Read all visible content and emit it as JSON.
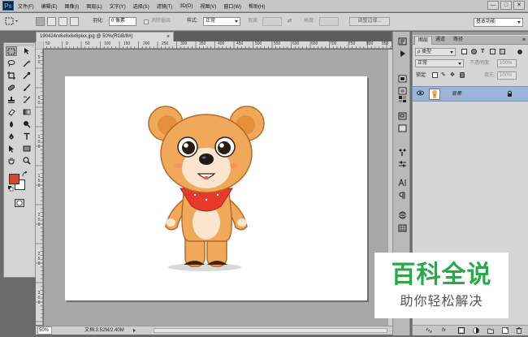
{
  "app": {
    "logo": "Ps"
  },
  "menu": [
    "文件(F)",
    "编辑(E)",
    "图像(I)",
    "图层(L)",
    "文字(Y)",
    "选择(S)",
    "滤镜(T)",
    "3D(D)",
    "视图(V)",
    "窗口(W)",
    "帮助(H)"
  ],
  "window_controls": {
    "minimize": "—",
    "restore": "□",
    "close": "✕"
  },
  "options": {
    "feather_label": "羽化:",
    "feather_value": "0 像素",
    "antialias_label": "消除锯齿",
    "style_label": "样式:",
    "style_value": "正常",
    "width_label": "宽度:",
    "height_label": "高度:",
    "refine_edge": "调整边缘...",
    "workspace": "基本功能"
  },
  "document": {
    "tab_title": "190424rx6x6x6x6pixx.jpg @ 50%(RGB/8#)",
    "tab_close": "×"
  },
  "rulers": {
    "h": [
      "50",
      "0",
      "50",
      "100",
      "150",
      "200",
      "250",
      "300",
      "350",
      "400",
      "450",
      "500",
      "550",
      "600",
      "650",
      "700",
      "750",
      "800",
      "850"
    ],
    "v": [
      "5",
      "0",
      "5",
      "0",
      "1",
      "0",
      "0",
      "1",
      "5",
      "0",
      "2",
      "0",
      "0",
      "2",
      "5",
      "0",
      "3",
      "0",
      "0"
    ]
  },
  "status": {
    "zoom": "50%",
    "doc_info": "文档:3.52M/2.40M"
  },
  "layers_panel": {
    "tabs": [
      "图层",
      "通道",
      "路径"
    ],
    "filter_label": "ρ 类型",
    "blend_mode": "正常",
    "opacity_label": "不透明度:",
    "opacity_value": "100%",
    "lock_label": "锁定:",
    "fill_label": "填充:",
    "fill_value": "100%",
    "layer_name": "背景"
  },
  "watermark": {
    "title": "百科全说",
    "subtitle": "助你轻松解决"
  },
  "colors": {
    "foreground": "#d64530",
    "background": "#ffffff",
    "selection": "#9cb4d8",
    "watermark_green": "#2aa84a"
  }
}
